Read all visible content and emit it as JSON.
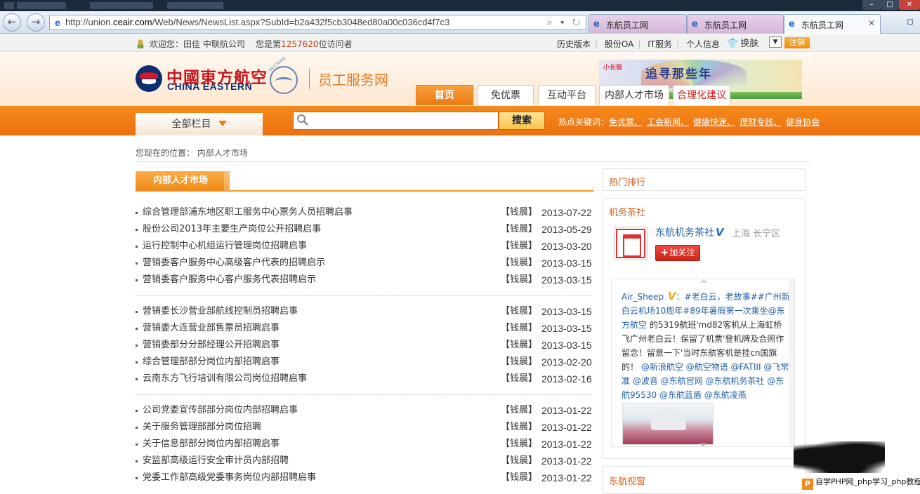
{
  "browser": {
    "url_prefix": "http://union.",
    "url_host": "ceair.com",
    "url_path": "/Web/News/NewsList.aspx?SubId=b2a432f5cb3048ed80a00c036cd4f7c3",
    "addr_tools": "⌕ ▾ ↻",
    "tabs": [
      {
        "label": "东航员工网"
      },
      {
        "label": "东航员工网"
      },
      {
        "label": "东航员工网",
        "close": "✕"
      }
    ]
  },
  "infobar": {
    "welcome_prefix": "欢迎您：田佳 中联航公司",
    "visitor_prefix": "您是第",
    "visitor_count": "1257620",
    "visitor_suffix": "位访问者",
    "links": [
      "历史版本",
      "股份OA",
      "IT服务",
      "个人信息"
    ],
    "skin_label": "换肤",
    "logout_label": "注销"
  },
  "header": {
    "logo_cn": "中國東方航空",
    "logo_en": "CHINA EASTERN",
    "skyteam": "SKYTEAM",
    "site_title": "员工服务网",
    "banner_kid": "小长假",
    "banner_line1": "追寻那些年",
    "banner_line2": "…",
    "nav_tabs": [
      {
        "label": "首页",
        "active": true
      },
      {
        "label": "免优票"
      },
      {
        "label": "互动平台"
      },
      {
        "label": "内部人才市场"
      },
      {
        "label": "合理化建议"
      }
    ]
  },
  "search": {
    "all_columns": "全部栏目",
    "placeholder": "",
    "button": "搜索",
    "hot_label": "热点关键词：",
    "hot_keywords": [
      "免优票、",
      "工会新闻、",
      "健康快速、",
      "理财专线、",
      "健身协会"
    ]
  },
  "breadcrumb": "您现在的位置： 内部人才市场",
  "list": {
    "heading": "内部人才市场",
    "groups": [
      [
        {
          "title": "综合管理部浦东地区职工服务中心票务人员招聘启事",
          "source": "【钱晨】",
          "date": "2013-07-22"
        },
        {
          "title": "股份公司2013年主要生产岗位公开招聘启事",
          "source": "【钱晨】",
          "date": "2013-05-29"
        },
        {
          "title": "运行控制中心机组运行管理岗位招聘启事",
          "source": "【钱晨】",
          "date": "2013-03-20"
        },
        {
          "title": "营销委客户服务中心高级客户代表的招聘启示",
          "source": "【钱晨】",
          "date": "2013-03-15"
        },
        {
          "title": "营销委客户服务中心客户服务代表招聘启示",
          "source": "【钱晨】",
          "date": "2013-03-15"
        }
      ],
      [
        {
          "title": "营销委长沙营业部航线控制员招聘启事",
          "source": "【钱晨】",
          "date": "2013-03-15"
        },
        {
          "title": "营销委大连营业部售票员招聘启事",
          "source": "【钱晨】",
          "date": "2013-03-15"
        },
        {
          "title": "营销委部分分部经理公开招聘启事",
          "source": "【钱晨】",
          "date": "2013-03-15"
        },
        {
          "title": "综合管理部部分岗位内部招聘启事",
          "source": "【钱晨】",
          "date": "2013-02-20"
        },
        {
          "title": "云南东方飞行培训有限公司岗位招聘启事",
          "source": "【钱晨】",
          "date": "2013-02-16"
        }
      ],
      [
        {
          "title": "公司党委宣传部部分岗位内部招聘启事",
          "source": "【钱晨】",
          "date": "2013-01-22"
        },
        {
          "title": "关于服务管理部部分岗位招聘",
          "source": "【钱晨】",
          "date": "2013-01-22"
        },
        {
          "title": "关于信息部部分岗位内部招聘启事",
          "source": "【钱晨】",
          "date": "2013-01-22"
        },
        {
          "title": "安监部高级运行安全审计员内部招聘",
          "source": "【钱晨】",
          "date": "2013-01-22"
        },
        {
          "title": "党委工作部高级党委事务岗位内部招聘启事",
          "source": "【钱晨】",
          "date": "2013-01-22"
        }
      ]
    ]
  },
  "sidebar": {
    "hot_rank_title": "热门排行",
    "weibo_title": "机务茶社",
    "weibo_name": "东航机务茶社",
    "weibo_verified": "V",
    "weibo_location": "上海 长宁区",
    "follow_plus": "+",
    "follow_label": "加关注",
    "post_user": "Air_Sheep",
    "post_user_badge": "V",
    "post_text_1": "：#老白云，老故事##广州新白云机场10周年#89年暑假第一次乘坐",
    "post_mention_1": "@东方航空",
    "post_text_2": " 的5319航班'md82客机从上海虹桥飞广州老白云！保留了机票'登机牌及合照作留念！留意一下'当时东航客机是挂cn国旗的！",
    "post_mentions_2": "@新浪航空 @航空物语 @FATIII @飞常准 @波音 @东航官网 @东航机务茶社 @东航95530 @东航蓝盾 @东航凌燕",
    "video_title": "东航视窗"
  },
  "watermark": {
    "logo": "P",
    "text": "自学PHP网_php学习_php教程"
  },
  "colors": {
    "brand_orange": "#ec7a12",
    "title_orange": "#e07a22",
    "logo_red": "#c8161e",
    "logo_navy": "#0d2f6f",
    "link_blue": "#1f5da6"
  }
}
